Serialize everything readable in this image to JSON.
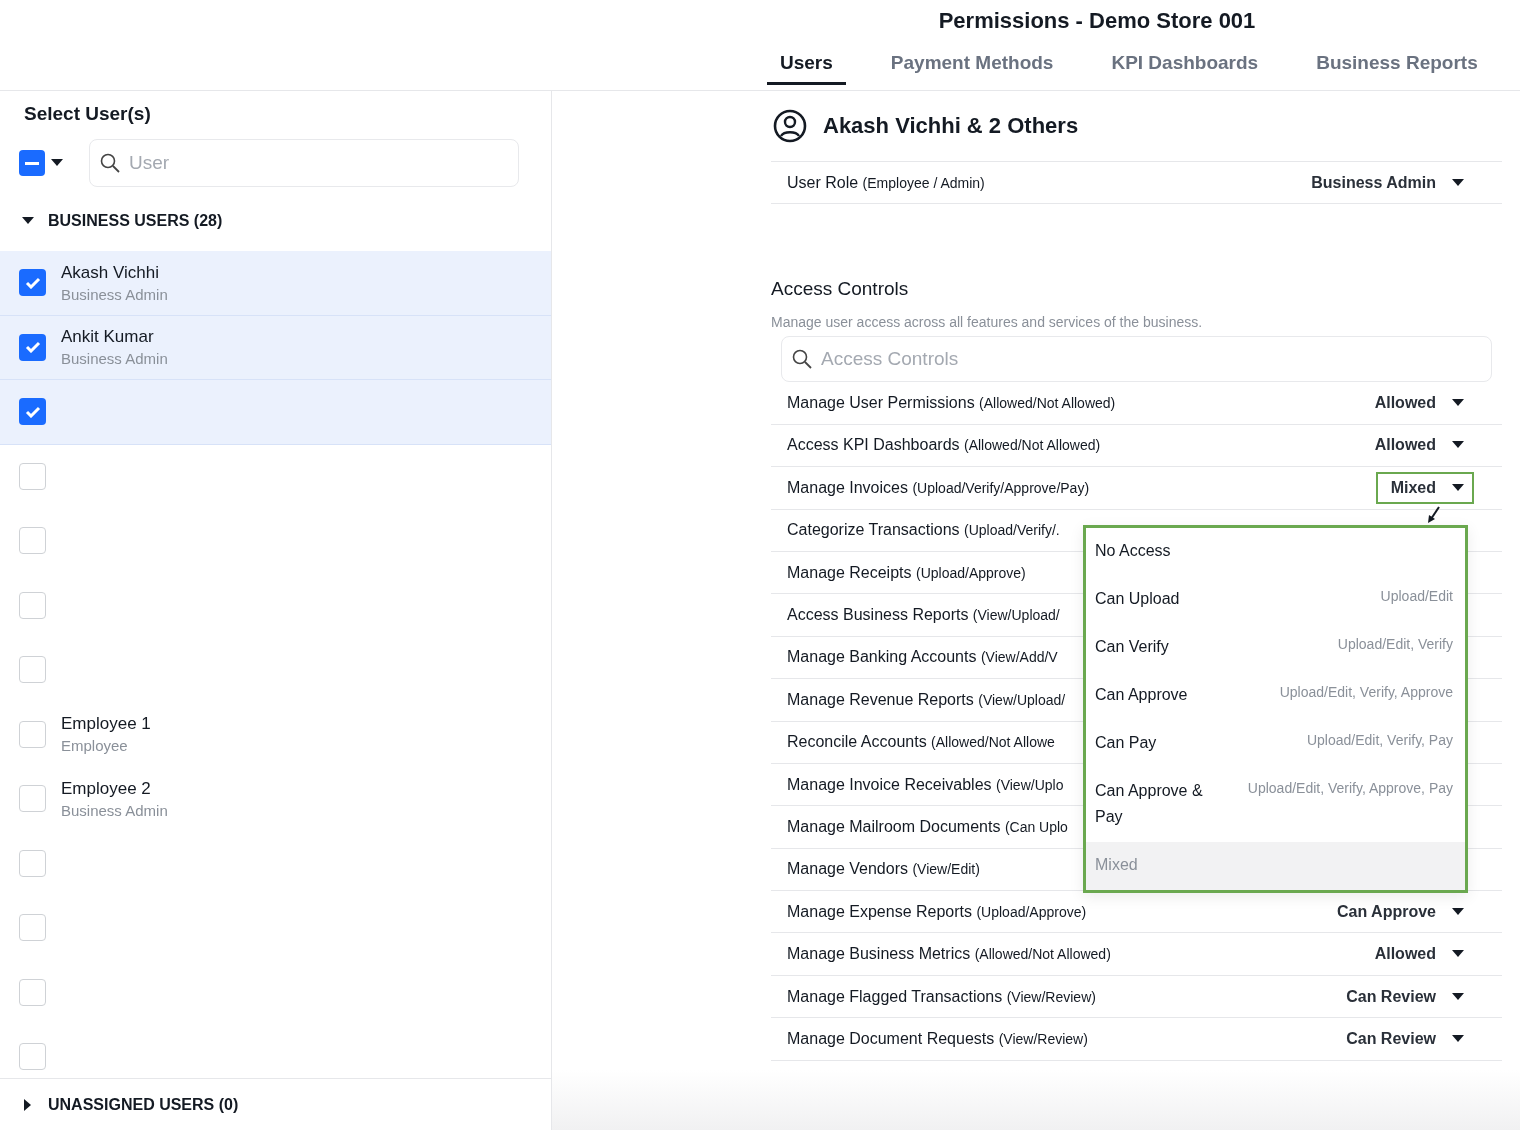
{
  "header": {
    "title": "Permissions - Demo Store 001"
  },
  "tabs": [
    {
      "label": "Users",
      "selected": true
    },
    {
      "label": "Payment Methods",
      "selected": false
    },
    {
      "label": "KPI Dashboards",
      "selected": false
    },
    {
      "label": "Business Reports",
      "selected": false
    }
  ],
  "sidebar": {
    "title": "Select User(s)",
    "select_all": {
      "indeterminate": true
    },
    "search": {
      "placeholder": "User"
    },
    "groups": [
      {
        "label": "BUSINESS USERS (28)",
        "expanded": true,
        "users": [
          {
            "name": "Akash Vichhi",
            "role": "Business Admin",
            "checked": true
          },
          {
            "name": "Ankit Kumar",
            "role": "Business Admin",
            "checked": true
          },
          {
            "checked": true
          },
          {
            "checked": false
          },
          {
            "checked": false
          },
          {
            "checked": false
          },
          {
            "checked": false
          },
          {
            "name": "Employee 1",
            "role": "Employee",
            "checked": false
          },
          {
            "name": "Employee 2",
            "role": "Business Admin",
            "checked": false
          },
          {
            "checked": false
          },
          {
            "checked": false
          },
          {
            "checked": false
          },
          {
            "checked": false
          }
        ]
      },
      {
        "label": "UNASSIGNED USERS (0)",
        "expanded": false
      }
    ]
  },
  "selection": {
    "title": "Akash Vichhi & 2 Others",
    "role": {
      "label": "User Role",
      "hint": "(Employee / Admin)",
      "value": "Business Admin"
    }
  },
  "access_controls": {
    "title": "Access Controls",
    "description": "Manage user access across all features and services of the business.",
    "search": {
      "placeholder": "Access Controls"
    },
    "rows": [
      {
        "label": "Manage User Permissions",
        "hint": "(Allowed/Not Allowed)",
        "value": "Allowed",
        "open": false
      },
      {
        "label": "Access KPI Dashboards",
        "hint": "(Allowed/Not Allowed)",
        "value": "Allowed",
        "open": false
      },
      {
        "label": "Manage Invoices",
        "hint": "(Upload/Verify/Approve/Pay)",
        "value": "Mixed",
        "open": true
      },
      {
        "label": "Categorize Transactions",
        "hint": "(Upload/Verify/."
      },
      {
        "label": "Manage Receipts",
        "hint": "(Upload/Approve)"
      },
      {
        "label": "Access Business Reports",
        "hint": "(View/Upload/"
      },
      {
        "label": "Manage Banking Accounts",
        "hint": "(View/Add/V"
      },
      {
        "label": "Manage Revenue Reports",
        "hint": "(View/Upload/"
      },
      {
        "label": "Reconcile Accounts",
        "hint": "(Allowed/Not Allowe"
      },
      {
        "label": "Manage Invoice Receivables",
        "hint": "(View/Uplo"
      },
      {
        "label": "Manage Mailroom Documents",
        "hint": "(Can Uplo"
      },
      {
        "label": "Manage Vendors",
        "hint": "(View/Edit)"
      },
      {
        "label": "Manage Expense Reports",
        "hint": "(Upload/Approve)",
        "value": "Can Approve",
        "open": false
      },
      {
        "label": "Manage Business Metrics",
        "hint": "(Allowed/Not Allowed)",
        "value": "Allowed",
        "open": false
      },
      {
        "label": "Manage Flagged Transactions",
        "hint": "(View/Review)",
        "value": "Can Review",
        "open": false
      },
      {
        "label": "Manage Document Requests",
        "hint": "(View/Review)",
        "value": "Can Review",
        "open": false
      }
    ],
    "menu": [
      {
        "label": "No Access",
        "selected": false
      },
      {
        "label": "Can Upload",
        "detail": "Upload/Edit",
        "selected": false
      },
      {
        "label": "Can Verify",
        "detail": "Upload/Edit, Verify",
        "selected": false
      },
      {
        "label": "Can Approve",
        "detail": "Upload/Edit, Verify, Approve",
        "selected": false
      },
      {
        "label": "Can Pay",
        "detail": "Upload/Edit, Verify, Pay",
        "selected": false
      },
      {
        "label": "Can Approve & Pay",
        "detail": "Upload/Edit, Verify, Approve, Pay",
        "selected": false
      },
      {
        "label": "Mixed",
        "selected": true
      }
    ]
  }
}
